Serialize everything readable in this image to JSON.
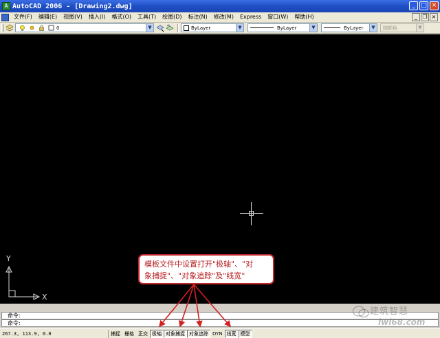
{
  "titlebar": {
    "app_icon_text": "A",
    "title": "AutoCAD 2006 - [Drawing2.dwg]",
    "minimize": "_",
    "maximize": "□",
    "close": "×"
  },
  "menubar": {
    "items": [
      {
        "label": "文件(F)"
      },
      {
        "label": "编辑(E)"
      },
      {
        "label": "视图(V)"
      },
      {
        "label": "插入(I)"
      },
      {
        "label": "格式(O)"
      },
      {
        "label": "工具(T)"
      },
      {
        "label": "绘图(D)"
      },
      {
        "label": "标注(N)"
      },
      {
        "label": "修改(M)"
      },
      {
        "label": "Express"
      },
      {
        "label": "窗口(W)"
      },
      {
        "label": "帮助(H)"
      }
    ],
    "doc_minimize": "_",
    "doc_restore": "❐",
    "doc_close": "×"
  },
  "toolbar": {
    "layer_value": "0",
    "color_value": "ByLayer",
    "linetype_value": "ByLayer",
    "lineweight_value": "ByLayer",
    "plotstyle_value": "随颜色"
  },
  "ucs": {
    "y_label": "Y",
    "x_label": "X"
  },
  "annotation": {
    "line1": "模板文件中设置打开\"极轴\"、\"对",
    "line2": "象捕捉\"、\"对象追踪\"及\"线宽\""
  },
  "command": {
    "line1": "命令:",
    "line2": "命令:"
  },
  "statusbar": {
    "coords": "267.3, 113.9, 0.0",
    "buttons": [
      {
        "label": "捕捉",
        "on": false
      },
      {
        "label": "栅格",
        "on": false
      },
      {
        "label": "正交",
        "on": false
      },
      {
        "label": "极轴",
        "on": true
      },
      {
        "label": "对象捕捉",
        "on": true
      },
      {
        "label": "对象追踪",
        "on": true
      },
      {
        "label": "DYN",
        "on": false
      },
      {
        "label": "线宽",
        "on": true
      },
      {
        "label": "模型",
        "on": true
      }
    ]
  },
  "watermark": {
    "text": "建筑智慧",
    "sub": "iwl68.com"
  },
  "colors": {
    "canvas": "#000000",
    "titlebar": "#1f4fc4",
    "annotation_red": "#c0262b"
  }
}
